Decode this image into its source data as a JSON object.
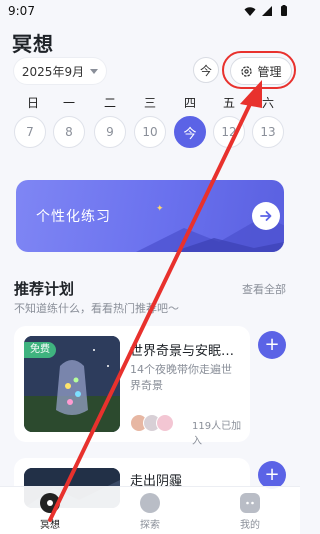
{
  "status_bar": {
    "time": "9:07"
  },
  "header": {
    "title": "冥想",
    "month": "2025年9月",
    "today_label": "今",
    "manage_label": "管理"
  },
  "week": {
    "days": [
      "日",
      "一",
      "二",
      "三",
      "四",
      "五",
      "六"
    ],
    "dates": [
      "7",
      "8",
      "9",
      "10",
      "今",
      "12",
      "13"
    ],
    "selected_index": 4
  },
  "practice_card": {
    "label": "个性化练习"
  },
  "recommend": {
    "title": "推荐计划",
    "see_all": "查看全部",
    "subtitle": "不知道练什么，看看热门推荐吧～",
    "plans": [
      {
        "tag": "免费",
        "title": "世界奇景与安眠…",
        "desc": "14个夜晚带你走遍世界奇景",
        "joined": "119人已加入",
        "add": "+"
      },
      {
        "title": "走出阴霾",
        "add": "+"
      }
    ]
  },
  "bottom_nav": [
    {
      "label": "冥想"
    },
    {
      "label": "探索"
    },
    {
      "label": "我的"
    }
  ],
  "colors": {
    "accent": "#5b63e6",
    "free_tag": "#3fb37f",
    "annotation": "#e8312d"
  }
}
